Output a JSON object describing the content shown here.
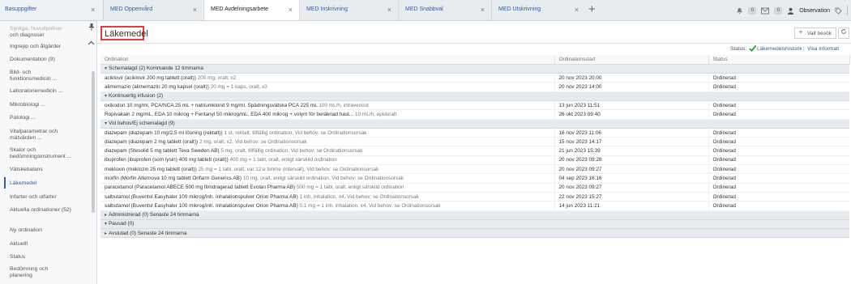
{
  "tabs": [
    {
      "label": "Basuppgifter",
      "active": false
    },
    {
      "label": "MED Oppenvård",
      "active": false
    },
    {
      "label": "MED Avdelningsarbete",
      "active": true
    },
    {
      "label": "MED Inskrivning",
      "active": false
    },
    {
      "label": "MED Snabbval",
      "active": false
    },
    {
      "label": "MED Utskrivning",
      "active": false
    }
  ],
  "tab_close_glyph": "×",
  "add_tab_glyph": "+",
  "toolbar": {
    "badge_1": "0",
    "badge_2": "0",
    "observation_label": "Observation"
  },
  "sidebar": {
    "items": [
      {
        "label": "Synliga, huvudpoliser"
      },
      {
        "label": "och diagnoser"
      },
      {
        "label": "Ingrepp och åtgärder"
      },
      {
        "label": "Dokumentation (9)"
      },
      {
        "label": "Bild- och funktionsmedicin ..."
      },
      {
        "label": "Laboratoriemedicin ..."
      },
      {
        "label": "Mikrobiologi ..."
      },
      {
        "label": "Patologi ..."
      },
      {
        "label": "Vitalparametrar och mätvärden ..."
      },
      {
        "label": "Skalor och bedömningsinstrument ..."
      },
      {
        "label": "Vätskebalans"
      },
      {
        "label": "Läkemedel",
        "active": true
      },
      {
        "label": "Infarter och utfarter"
      },
      {
        "label": "Aktuella ordinationer (52)"
      },
      {
        "label": "Ny ordination"
      },
      {
        "label": "Aktuellt"
      },
      {
        "label": "Status"
      },
      {
        "label": "Bedömning och planering"
      }
    ]
  },
  "main": {
    "title": "Läkemedel",
    "valt_besok_label": "Valt besök",
    "status_label": "Status:",
    "history_link": "Läkemedelshistorik",
    "separator": "|",
    "show_info_link": "Visa informati",
    "columns": [
      "Ordination",
      "Ordinationsstart",
      "Status"
    ],
    "groups": [
      {
        "label": "Schemalagd (2) Kommande 12 timmarna",
        "expanded": true,
        "rows": [
          {
            "med": "aciklovir (aciklovir 200 mg tablett (oralt))",
            "detail": "200 mg, oralt, x2",
            "start": "20 nov 2023 20:00",
            "status": "Ordinerad"
          },
          {
            "med": "alimemazin (alimemazin 20 mg kapsel (oralt))",
            "detail": "20 mg = 1 kaps, oralt, x3",
            "start": "20 nov 2023 14:00",
            "status": "Ordinerad"
          }
        ]
      },
      {
        "label": "Kontinuerlig infusion (2)",
        "expanded": true,
        "rows": [
          {
            "med": "oxikodon 10 mg/ml, PCA/NCA 25 mL + natriumklorid 9 mg/ml, Spädningsvätska PCA 225 mL",
            "detail": "100 mL/h, intravenöst",
            "start": "13 jun 2023 11:51",
            "status": "Ordinerad"
          },
          {
            "med": "Ropivakain 2 mg/mL, EDA 10 mikrog + Fentanyl 50 mikrog/mL, EDA 400 mikrog + volym för beräknad hast...",
            "detail": "10 mL/h, epiduralt",
            "start": "26 okt 2023 09:40",
            "status": "Ordinerad"
          }
        ]
      },
      {
        "label": "Vid behov/Ej schemalagd (9)",
        "expanded": true,
        "rows": [
          {
            "med": "diazepam (diazepam 10 mg/2,5 ml lösning (rektalt))",
            "detail": "1 st, rektalt, tillfällig ordination, Vid behov: se Ordinationsorsak",
            "start": "16 nov 2023 11:06",
            "status": "Ordinerad"
          },
          {
            "med": "diazepam (diazepam 2 mg tablett (oralt))",
            "detail": "2 mg, oralt, x2, Vid behov: se Ordinationsorsak",
            "start": "15 nov 2023 14:17",
            "status": "Ordinerad"
          },
          {
            "med": "diazepam (Stesolid 5 mg tablett Teva Sweden AB)",
            "detail": "5 mg, oralt, tillfällig ordination, Vid behov: se Ordinationsorsak",
            "start": "21 jun 2023 15:39",
            "status": "Ordinerad"
          },
          {
            "med": "ibuprofen (ibuprofen (som lysin) 400 mg tablett (oralt))",
            "detail": "400 mg = 1 tabl, oralt, enligt särskild ordination",
            "start": "20 nov 2023 09:28",
            "status": "Ordinerad"
          },
          {
            "med": "mekloxin (meklozin 25 mg tablett (oralt))",
            "detail": "25 mg = 1 tabl, oralt, var 12:e timme (intervall), Vid behov: se Ordinationsorsak",
            "start": "20 nov 2023 09:27",
            "status": "Ordinerad"
          },
          {
            "med": "morfin (Morfin Alternova 10 mg tablett Orifarm Generics AB)",
            "detail": "10 mg, oralt, enligt särskild ordination, Vid behov: se Ordinationsorsak",
            "start": "04 sep 2023 16:16",
            "status": "Ordinerad"
          },
          {
            "med": "paracetamol (Paracetamol ABECE 500 mg filmdragerad tablett Evolan Pharma AB)",
            "detail": "500 mg = 1 tabl, oralt, enligt särskild ordination",
            "start": "20 nov 2023 09:27",
            "status": "Ordinerad"
          },
          {
            "med": "salbutamol (Buventol Easyhaler 100 mikrog/inh. inhalationspulver Orion Pharma AB)",
            "detail": "1 inh, inhalation, x4, Vid behov: se Ordinationsorsak",
            "start": "22 nov 2023 15:27",
            "status": "Ordinerad"
          },
          {
            "med": "salbutamol (Buventol Easyhaler 100 mikrog/inh. inhalationspulver Orion Pharma AB)",
            "detail": "0,1 mg = 1 inh, inhalation, x4, Vid behov: se Ordinationsorsak",
            "start": "14 jun 2023 11:21",
            "status": "Ordinerad"
          }
        ]
      },
      {
        "label": "Administrerad (0) Senaste 24 timmarna",
        "expanded": false,
        "rows": []
      },
      {
        "label": "Pausad (0)",
        "expanded": true,
        "rows": []
      },
      {
        "label": "Avslutad (0) Senaste 24 timmarna",
        "expanded": false,
        "rows": []
      }
    ]
  },
  "colors": {
    "accent": "#2f5d9a",
    "highlight_box": "#e23b3b",
    "status_ok": "#2e9b3a"
  }
}
